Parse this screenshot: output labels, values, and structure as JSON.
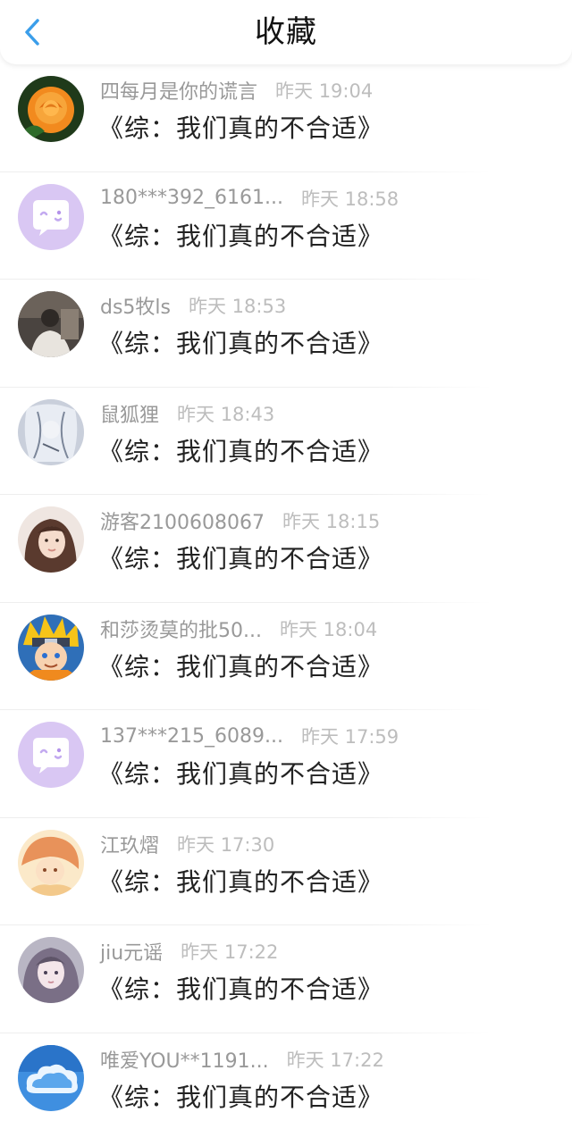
{
  "header": {
    "title": "收藏",
    "back_icon": "chevron-left-icon",
    "accent_color": "#3b9eea"
  },
  "items": [
    {
      "username": "四每月是你的谎言",
      "time": "昨天 19:04",
      "title": "《综：我们真的不合适》",
      "avatar": "rose-avatar"
    },
    {
      "username": "180***392_6161...",
      "time": "昨天 18:58",
      "title": "《综：我们真的不合适》",
      "avatar": "default-chat-avatar"
    },
    {
      "username": "ds5牧ls",
      "time": "昨天 18:53",
      "title": "《综：我们真的不合适》",
      "avatar": "photo-avatar"
    },
    {
      "username": "鼠狐狸",
      "time": "昨天 18:43",
      "title": "《综：我们真的不合适》",
      "avatar": "anime-avatar"
    },
    {
      "username": "游客2100608067",
      "time": "昨天 18:15",
      "title": "《综：我们真的不合适》",
      "avatar": "girl-avatar"
    },
    {
      "username": "和莎烫莫的批50...",
      "time": "昨天 18:04",
      "title": "《综：我们真的不合适》",
      "avatar": "naruto-avatar"
    },
    {
      "username": "137***215_6089...",
      "time": "昨天 17:59",
      "title": "《综：我们真的不合适》",
      "avatar": "default-chat-avatar"
    },
    {
      "username": "江玖熠",
      "time": "昨天 17:30",
      "title": "《综：我们真的不合适》",
      "avatar": "illustration-avatar"
    },
    {
      "username": "jiu元谣",
      "time": "昨天 17:22",
      "title": "《综：我们真的不合适》",
      "avatar": "anime-girl-avatar"
    },
    {
      "username": "唯爱YOU**1191...",
      "time": "昨天 17:22",
      "title": "《综：我们真的不合适》",
      "avatar": "cloud-avatar"
    }
  ]
}
